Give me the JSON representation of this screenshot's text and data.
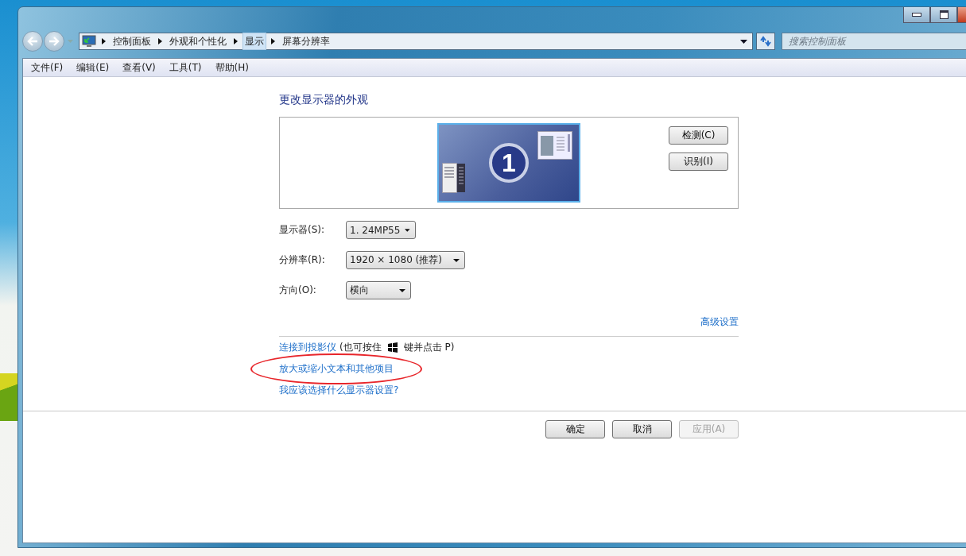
{
  "address_bar": {
    "crumbs": [
      {
        "label": "控制面板",
        "selected": false
      },
      {
        "label": "外观和个性化",
        "selected": false
      },
      {
        "label": "显示",
        "selected": true
      },
      {
        "label": "屏幕分辨率",
        "selected": false
      }
    ]
  },
  "search": {
    "placeholder": "搜索控制面板"
  },
  "menu": [
    "文件(F)",
    "编辑(E)",
    "查看(V)",
    "工具(T)",
    "帮助(H)"
  ],
  "heading": "更改显示器的外观",
  "monitor": {
    "number": "1"
  },
  "side_buttons": [
    "检测(C)",
    "识别(I)"
  ],
  "settings": [
    {
      "label": "显示器(S):",
      "value": "1. 24MP55"
    },
    {
      "label": "分辨率(R):",
      "value": "1920 × 1080 (推荐)"
    },
    {
      "label": "方向(O):",
      "value": "横向"
    }
  ],
  "advanced_link": "高级设置",
  "projector": {
    "link": "连接到投影仪",
    "note_before": "(也可按住",
    "note_after": "键并点击 P)"
  },
  "links": [
    {
      "text": "放大或缩小文本和其他项目",
      "circled": true
    },
    {
      "text": "我应该选择什么显示器设置?",
      "circled": false
    }
  ],
  "buttons": [
    {
      "label": "确定",
      "disabled": false
    },
    {
      "label": "取消",
      "disabled": false
    },
    {
      "label": "应用(A)",
      "disabled": true
    }
  ]
}
